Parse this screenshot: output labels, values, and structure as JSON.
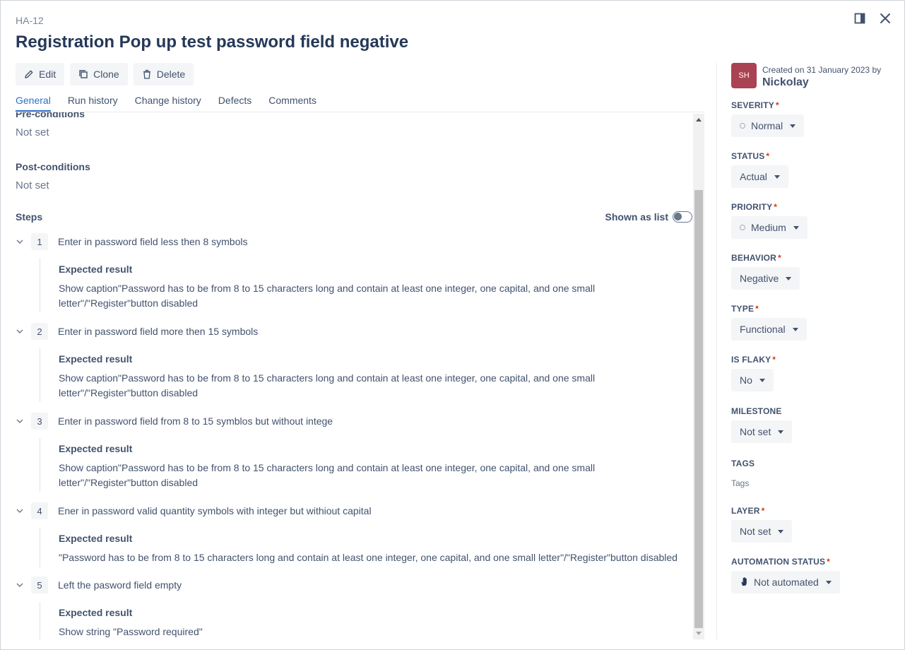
{
  "header": {
    "key": "HA-12",
    "title": "Registration Pop up test password field negative"
  },
  "toolbar": {
    "edit": "Edit",
    "clone": "Clone",
    "delete": "Delete"
  },
  "tabs": [
    "General",
    "Run history",
    "Change history",
    "Defects",
    "Comments"
  ],
  "general": {
    "preconditions_label": "Pre-conditions",
    "preconditions_value": "Not set",
    "postconditions_label": "Post-conditions",
    "postconditions_value": "Not set",
    "steps_label": "Steps",
    "shown_as_list": "Shown as list",
    "expected_label": "Expected result",
    "steps": [
      {
        "num": "1",
        "action": "Enter in password field less then 8 symbols",
        "expected": "Show caption\"Password has to be from 8 to 15 characters long and contain at least one integer, one capital, and one small letter\"/\"Register\"button disabled"
      },
      {
        "num": "2",
        "action": "Enter in password field more then 15 symbols",
        "expected": "Show caption\"Password has to be from 8 to 15 characters long and contain at least one integer, one capital, and one small letter\"/\"Register\"button disabled"
      },
      {
        "num": "3",
        "action": "Enter in password field from 8 to 15 symblos but without intege",
        "expected": "Show caption\"Password has to be from 8 to 15 characters long and contain at least one integer, one capital, and one small letter\"/\"Register\"button disabled"
      },
      {
        "num": "4",
        "action": "Ener in password valid quantity symbols with integer but withiout capital",
        "expected": "\"Password has to be from 8 to 15 characters long and contain at least one integer, one capital, and one small letter\"/\"Register\"button disabled"
      },
      {
        "num": "5",
        "action": "Left the pasword field empty",
        "expected": "Show string \"Password required\""
      }
    ]
  },
  "sidebar": {
    "avatar_initials": "SH",
    "avatar_color": "#a94252",
    "created_on": "Created on 31 January 2023 by",
    "created_by": "Nickolay",
    "severity": {
      "label": "SEVERITY",
      "value": "Normal"
    },
    "status": {
      "label": "STATUS",
      "value": "Actual"
    },
    "priority": {
      "label": "PRIORITY",
      "value": "Medium"
    },
    "behavior": {
      "label": "BEHAVIOR",
      "value": "Negative"
    },
    "type": {
      "label": "TYPE",
      "value": "Functional"
    },
    "is_flaky": {
      "label": "IS FLAKY",
      "value": "No"
    },
    "milestone": {
      "label": "MILESTONE",
      "value": "Not set"
    },
    "tags": {
      "label": "TAGS",
      "placeholder": "Tags"
    },
    "layer": {
      "label": "LAYER",
      "value": "Not set"
    },
    "automation_status": {
      "label": "AUTOMATION STATUS",
      "value": "Not automated"
    }
  },
  "icons": {
    "edit": "pencil-icon",
    "clone": "copy-icon",
    "delete": "trash-icon",
    "panel": "panel-toggle-icon",
    "close": "close-icon",
    "automation": "hand-icon"
  },
  "colors": {
    "accent": "#2f6fc7",
    "required": "#de350b"
  }
}
